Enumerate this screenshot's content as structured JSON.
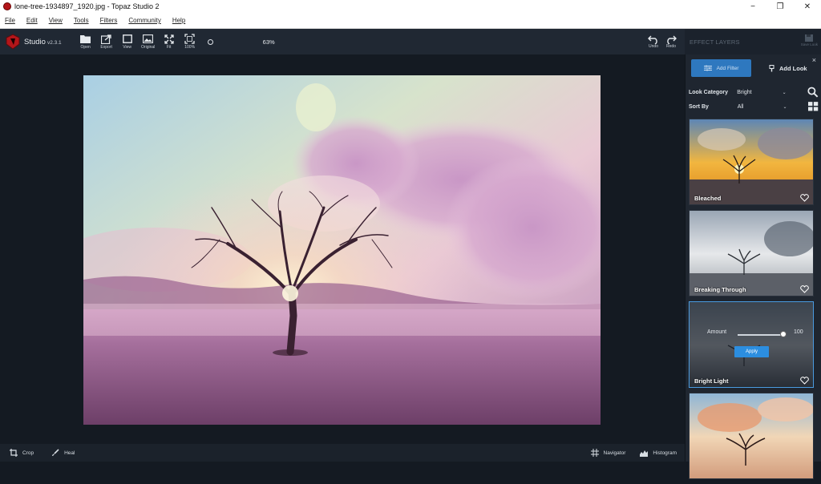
{
  "window": {
    "title": "lone-tree-1934897_1920.jpg - Topaz Studio 2",
    "minimize": "−",
    "maximize": "❐",
    "close": "✕"
  },
  "menu": [
    "File",
    "Edit",
    "View",
    "Tools",
    "Filters",
    "Community",
    "Help"
  ],
  "toolbar": {
    "brand": "Studio",
    "version": "v2.3.1",
    "buttons": [
      {
        "label": "Open",
        "icon": "folder-icon"
      },
      {
        "label": "Export",
        "icon": "export-icon"
      },
      {
        "label": "View",
        "icon": "view-icon"
      },
      {
        "label": "Original",
        "icon": "image-icon"
      },
      {
        "label": "Fit",
        "icon": "fit-icon"
      },
      {
        "label": "100%",
        "icon": "actual-size-icon"
      }
    ],
    "zoom": "63%",
    "undo": "Undo",
    "redo": "Redo"
  },
  "panel": {
    "header": "EFFECT LAYERS",
    "save_look": "Save Look",
    "close": "×",
    "add_filter": "Add Filter",
    "add_look": "Add Look",
    "look_category_label": "Look Category",
    "look_category_value": "Bright",
    "sort_by_label": "Sort By",
    "sort_by_value": "All",
    "looks": [
      {
        "name": "Bleached"
      },
      {
        "name": "Breaking Through"
      },
      {
        "name": "Bright Light"
      },
      {
        "name": ""
      }
    ],
    "amount_label": "Amount",
    "amount_value": "100",
    "apply": "Apply"
  },
  "bottom": {
    "crop": "Crop",
    "heal": "Heal",
    "navigator": "Navigator",
    "histogram": "Histogram"
  }
}
